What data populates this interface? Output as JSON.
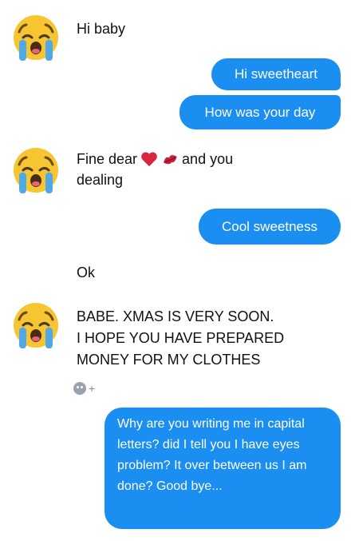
{
  "messages": {
    "m1": {
      "text": "Hi baby"
    },
    "m2": {
      "text": "Hi sweetheart"
    },
    "m3": {
      "text": "How was your day"
    },
    "m4": {
      "line1": "Fine dear",
      "line1_after": "and you",
      "line2": "dealing"
    },
    "m5": {
      "text": "Cool sweetness"
    },
    "m6": {
      "text": "Ok"
    },
    "m7": {
      "line1": "BABE. XMAS IS VERY SOON.",
      "line2": "I HOPE YOU HAVE PREPARED",
      "line3": "MONEY FOR MY CLOTHES"
    },
    "m8": {
      "text": "Why are you writing me in capital letters? did I tell you I have eyes problem? It over between us I am done? Good bye..."
    }
  },
  "reaction": {
    "plus": "+"
  },
  "colors": {
    "outgoing_bubble": "#1b8ef2",
    "incoming_text": "#111111",
    "background": "#ffffff"
  },
  "icons": {
    "avatar": "crying-face-emoji",
    "heart": "red-heart-emoji",
    "kiss": "kiss-mark-emoji",
    "reaction": "add-reaction-icon"
  }
}
